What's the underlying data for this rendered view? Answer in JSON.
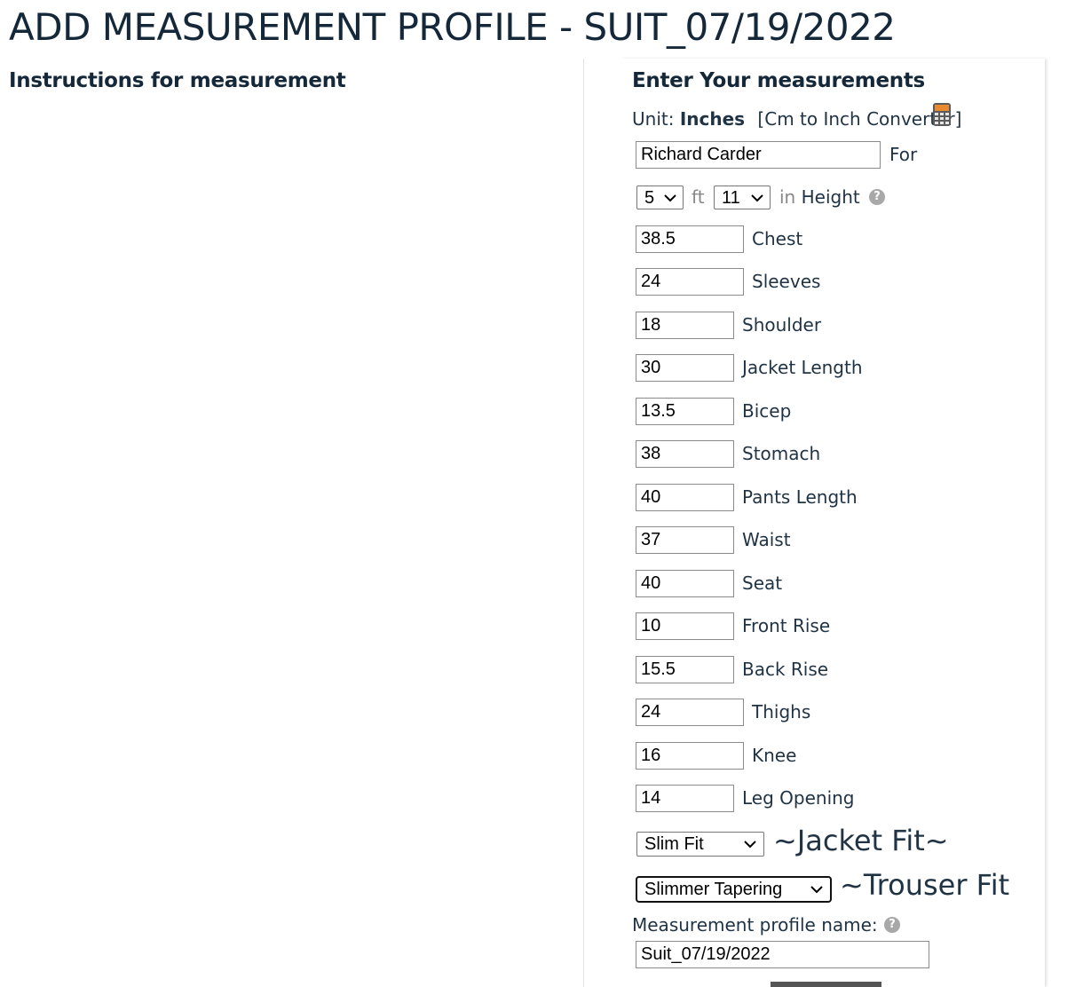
{
  "page": {
    "title": "ADD MEASUREMENT PROFILE - SUIT_07/19/2022"
  },
  "left": {
    "heading": "Instructions for measurement"
  },
  "form": {
    "heading": "Enter Your measurements",
    "unit_prefix": "Unit:",
    "unit_value": "Inches",
    "converter_label": "[Cm to Inch Convertor]",
    "name": {
      "value": "Richard Carder",
      "label": "For"
    },
    "height": {
      "feet": "5",
      "feet_label": "ft",
      "inches": "11",
      "inches_label": "in",
      "label": "Height"
    },
    "measurements": [
      {
        "value": "38.5",
        "label": "Chest"
      },
      {
        "value": "24",
        "label": "Sleeves"
      },
      {
        "value": "18",
        "label": "Shoulder"
      },
      {
        "value": "30",
        "label": "Jacket Length"
      },
      {
        "value": "13.5",
        "label": "Bicep"
      },
      {
        "value": "38",
        "label": "Stomach"
      },
      {
        "value": "40",
        "label": "Pants Length"
      },
      {
        "value": "37",
        "label": "Waist"
      },
      {
        "value": "40",
        "label": "Seat"
      },
      {
        "value": "10",
        "label": "Front Rise"
      },
      {
        "value": "15.5",
        "label": "Back Rise"
      },
      {
        "value": "24",
        "label": "Thighs"
      },
      {
        "value": "16",
        "label": "Knee"
      },
      {
        "value": "14",
        "label": "Leg Opening"
      }
    ],
    "jacket_fit": {
      "value": "Slim Fit",
      "label": "~Jacket Fit~"
    },
    "trouser_fit": {
      "value": "Slimmer Tapering",
      "label": "~Trouser Fit"
    },
    "profile_name": {
      "label": "Measurement profile name:",
      "value": "Suit_07/19/2022"
    }
  },
  "icons": {
    "calculator": "calculator-icon",
    "help": "help-icon",
    "chevron": "chevron-down-icon"
  }
}
